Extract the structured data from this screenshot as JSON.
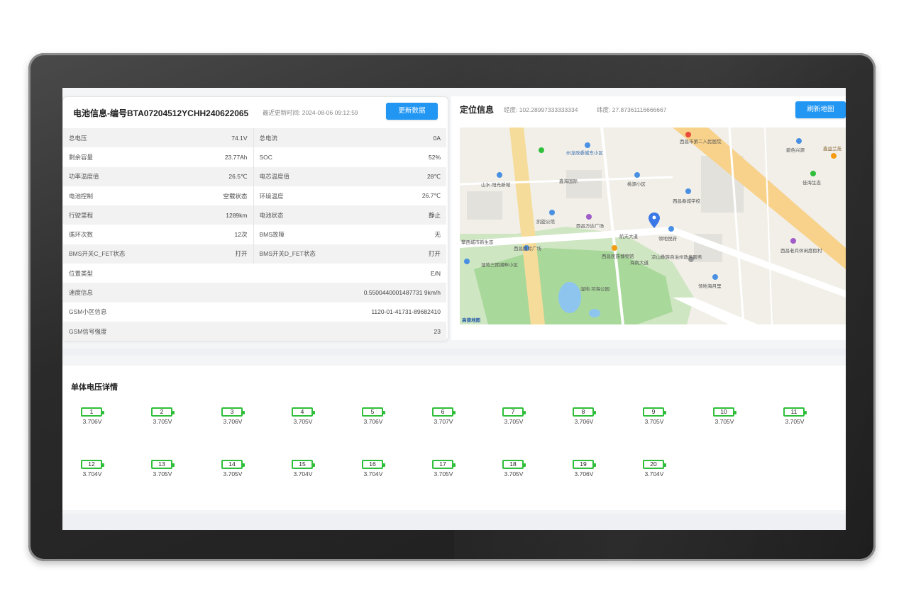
{
  "battery": {
    "title": "电池信息-编号BTA07204512YCHH240622065",
    "last_update": "最近更新时间: 2024-08-06 09:12:59",
    "update_button": "更新数据",
    "rows": [
      {
        "l1": "总电压",
        "v1": "74.1V",
        "l2": "总电流",
        "v2": "0A"
      },
      {
        "l1": "剩余容量",
        "v1": "23.77Ah",
        "l2": "SOC",
        "v2": "52%"
      },
      {
        "l1": "功率温度值",
        "v1": "26.5℃",
        "l2": "电芯温度值",
        "v2": "28℃"
      },
      {
        "l1": "电池控制",
        "v1": "空载状态",
        "l2": "环境温度",
        "v2": "26.7℃"
      },
      {
        "l1": "行驶里程",
        "v1": "1289km",
        "l2": "电池状态",
        "v2": "静止"
      },
      {
        "l1": "循环次数",
        "v1": "12次",
        "l2": "BMS故障",
        "v2": "无"
      },
      {
        "l1": "BMS开关C_FET状态",
        "v1": "打开",
        "l2": "BMS开关D_FET状态",
        "v2": "打开"
      }
    ],
    "full_rows": [
      {
        "label": "位置类型",
        "value": "E/N"
      },
      {
        "label": "速度信息",
        "value": "0.5500440001487731 9km/h"
      },
      {
        "label": "GSM小区信息",
        "value": "1120-01-41731-89682410"
      },
      {
        "label": "GSM信号强度",
        "value": "23"
      }
    ]
  },
  "location": {
    "title": "定位信息",
    "longitude": "经度: 102.28997333333334",
    "latitude": "纬度: 27.87361116666667",
    "refresh_button": "刷新地图",
    "map_labels": [
      {
        "text": "州龙政委城东小区"
      },
      {
        "text": "西昌市第二人民医院"
      },
      {
        "text": "鑫海国际"
      },
      {
        "text": "山水·阳光新城"
      },
      {
        "text": "桃源小区"
      },
      {
        "text": "西昌春城学校"
      },
      {
        "text": "凯旋公馆"
      },
      {
        "text": "西昌万达广场"
      },
      {
        "text": "领地悦府"
      },
      {
        "text": "航天大道"
      },
      {
        "text": "攀西城市新生态"
      },
      {
        "text": "西昌国际广场"
      },
      {
        "text": "海南大道"
      },
      {
        "text": "西昌民族博物馆"
      },
      {
        "text": "凉山彝族自治州政务服务"
      },
      {
        "text": "湿地三期湖畔小区"
      },
      {
        "text": "西昌老兵休闲度假村"
      },
      {
        "text": "领地海月里"
      },
      {
        "text": "湿地·邛海公园"
      },
      {
        "text": "碧色兴源"
      },
      {
        "text": "佳海生态"
      },
      {
        "text": "鑫益兰苑"
      }
    ],
    "map_logo": "高德地图"
  },
  "cells": {
    "title": "单体电压详情",
    "items": [
      {
        "n": "1",
        "v": "3.706V"
      },
      {
        "n": "2",
        "v": "3.705V"
      },
      {
        "n": "3",
        "v": "3.706V"
      },
      {
        "n": "4",
        "v": "3.705V"
      },
      {
        "n": "5",
        "v": "3.706V"
      },
      {
        "n": "6",
        "v": "3.707V"
      },
      {
        "n": "7",
        "v": "3.705V"
      },
      {
        "n": "8",
        "v": "3.706V"
      },
      {
        "n": "9",
        "v": "3.705V"
      },
      {
        "n": "10",
        "v": "3.705V"
      },
      {
        "n": "11",
        "v": "3.705V"
      },
      {
        "n": "12",
        "v": "3.704V"
      },
      {
        "n": "13",
        "v": "3.705V"
      },
      {
        "n": "14",
        "v": "3.705V"
      },
      {
        "n": "15",
        "v": "3.704V"
      },
      {
        "n": "16",
        "v": "3.704V"
      },
      {
        "n": "17",
        "v": "3.705V"
      },
      {
        "n": "18",
        "v": "3.705V"
      },
      {
        "n": "19",
        "v": "3.706V"
      },
      {
        "n": "20",
        "v": "3.704V"
      }
    ]
  },
  "colors": {
    "accent": "#2196f3",
    "cell_green": "#2fbf3a"
  }
}
